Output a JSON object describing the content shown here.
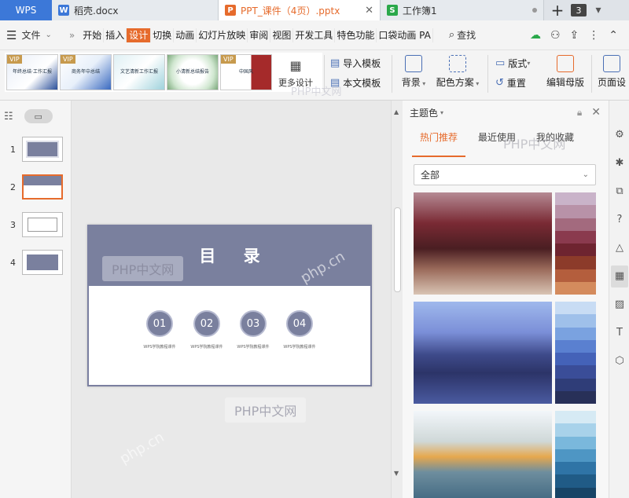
{
  "tabs": {
    "app": "WPS",
    "documents": [
      {
        "label": "稻壳.docx",
        "icon": "W",
        "color": "#3c78d8"
      },
      {
        "label": "PPT_课件（4页）.pptx",
        "icon": "P",
        "color": "#e66b2c"
      },
      {
        "label": "工作簿1",
        "icon": "S",
        "color": "#2aa84a"
      }
    ],
    "add": "+",
    "count": "3"
  },
  "menu": {
    "file": "文件",
    "items": [
      "开始",
      "插入",
      "设计",
      "切换",
      "动画",
      "幻灯片放映",
      "审阅",
      "视图",
      "开发工具",
      "特色功能",
      "口袋动画 PA"
    ],
    "active_index": 2,
    "search": "查找"
  },
  "ribbon": {
    "gallery": [
      {
        "vip": "VIP",
        "text": "年终总结·工作汇报"
      },
      {
        "vip": "VIP",
        "text": "商务年中总结"
      },
      {
        "vip": "",
        "text": "文艺清新工作汇报"
      },
      {
        "vip": "",
        "text": "小清新总结报告"
      },
      {
        "vip": "VIP",
        "text": "中国风"
      }
    ],
    "more_design": "更多设计",
    "import_template": "导入模板",
    "this_template": "本文模板",
    "background": "背景",
    "color_scheme": "配色方案",
    "layout": "版式",
    "reset": "重置",
    "edit_master": "编辑母版",
    "page_setup": "页面设"
  },
  "slides": {
    "numbers": [
      "1",
      "2",
      "3",
      "4"
    ],
    "selected_index": 1
  },
  "slide": {
    "title": "目 录",
    "items": [
      {
        "num": "01",
        "caption": "WPS学院教程课件"
      },
      {
        "num": "02",
        "caption": "WPS学院教程课件"
      },
      {
        "num": "03",
        "caption": "WPS学院教程课件"
      },
      {
        "num": "04",
        "caption": "WPS学院教程课件"
      }
    ]
  },
  "right_panel": {
    "title": "主题色",
    "tabs": [
      "热门推荐",
      "最近使用",
      "我的收藏"
    ],
    "active_tab": 0,
    "filter": "全部",
    "schemes": [
      {
        "swatches": [
          "#c9b3c9",
          "#b892a8",
          "#a36a7e",
          "#8a3a4e",
          "#6e2430",
          "#8c3b2a",
          "#b45e3d",
          "#d48b5d"
        ]
      },
      {
        "swatches": [
          "#c8dcf4",
          "#9fc0ea",
          "#7aa2e0",
          "#5a80d0",
          "#4462b8",
          "#3a4d98",
          "#2f3d78",
          "#283058"
        ]
      },
      {
        "swatches": [
          "#d6eaf4",
          "#a8d2ea",
          "#7ab8dc",
          "#4e96c4",
          "#2f74a6",
          "#205b86",
          "#174466",
          "#0f3048"
        ]
      }
    ]
  },
  "watermark": "PHP中文网",
  "watermark_small": "php.cn"
}
